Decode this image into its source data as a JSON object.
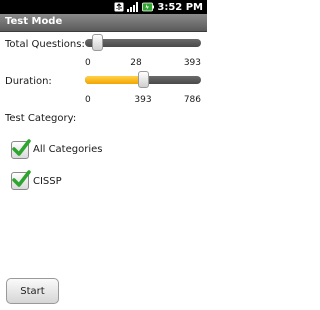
{
  "status_bar": {
    "time": "3:52 PM",
    "icons": [
      "usb-icon",
      "signal-icon",
      "battery-icon"
    ]
  },
  "title_bar": {
    "title": "Test Mode"
  },
  "total_questions": {
    "label": "Total Questions:",
    "min": "0",
    "current": "28",
    "max": "393",
    "value_fraction": 0.07
  },
  "duration": {
    "label": "Duration:",
    "min": "0",
    "current": "393",
    "max": "786",
    "value_fraction": 0.5
  },
  "test_category": {
    "label": "Test Category:",
    "options": [
      {
        "label": "All Categories",
        "checked": true
      },
      {
        "label": "CISSP",
        "checked": true
      }
    ]
  },
  "start_button": {
    "label": "Start"
  },
  "colors": {
    "status_bar_bg": "#000000",
    "title_bar_bg": "#6e6e6e",
    "slider_fill": "#f7b500",
    "check_green": "#2ea52e"
  }
}
